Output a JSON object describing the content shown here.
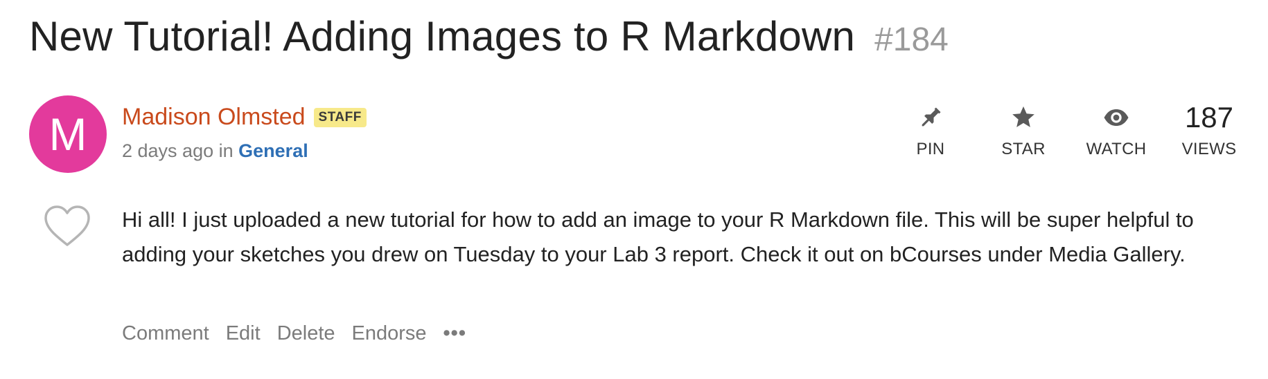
{
  "post": {
    "title": "New Tutorial! Adding Images to R Markdown",
    "number": "#184",
    "author": {
      "initial": "M",
      "name": "Madison Olmsted",
      "badge": "STAFF",
      "avatar_color": "#e33a9c"
    },
    "meta": {
      "time": "2 days ago",
      "in_text": "in",
      "category": "General"
    },
    "actions": {
      "pin": {
        "label": "PIN",
        "icon": "pin-icon"
      },
      "star": {
        "label": "STAR",
        "icon": "star-icon"
      },
      "watch": {
        "label": "WATCH",
        "icon": "eye-icon"
      },
      "views": {
        "count": "187",
        "label": "VIEWS"
      }
    },
    "like_icon": "heart-icon",
    "body": "Hi all! I just uploaded a new tutorial for how to add an image to your R Markdown file. This will be super helpful to adding your sketches you drew on Tuesday to your Lab 3 report. Check it out on bCourses under Media Gallery.",
    "footer": {
      "comment": "Comment",
      "edit": "Edit",
      "delete": "Delete",
      "endorse": "Endorse",
      "more": "•••"
    }
  },
  "colors": {
    "author": "#c94a1c",
    "category": "#2e6fb5",
    "badge_bg": "#f7e98a",
    "muted": "#7b7b7b"
  }
}
